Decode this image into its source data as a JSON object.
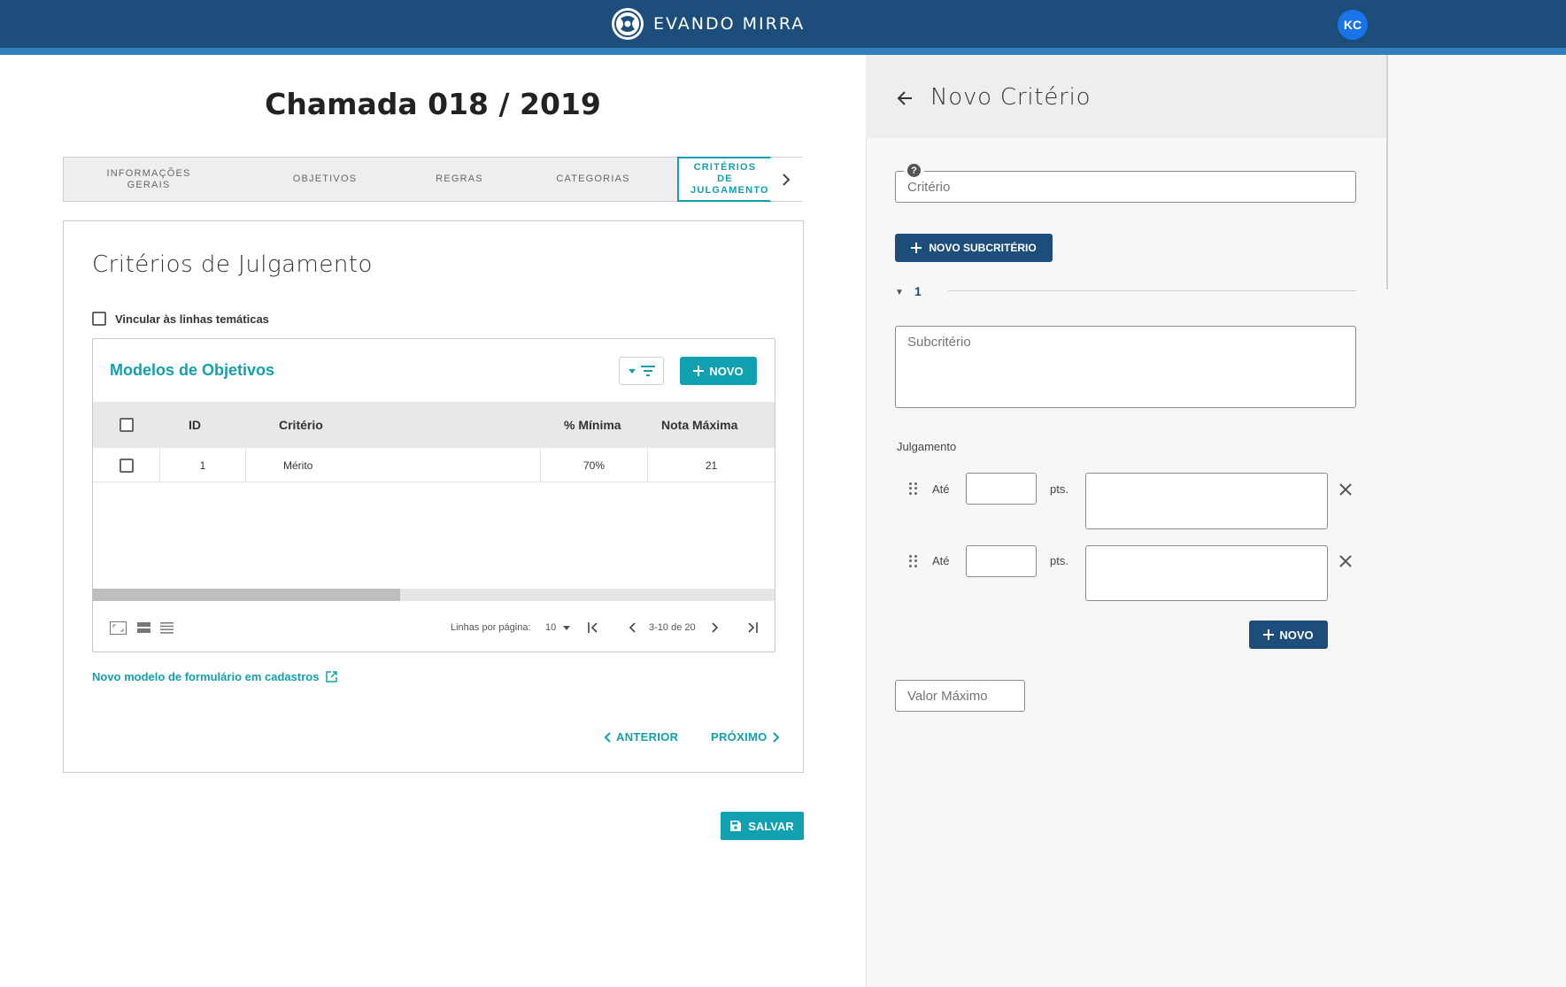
{
  "header": {
    "brand": "EVANDO MIRRA",
    "avatar_initials": "KC"
  },
  "page": {
    "title": "Chamada 018 / 2019"
  },
  "stepper": {
    "steps": [
      {
        "label": "INFORMAÇÕES GERAIS"
      },
      {
        "label": "OBJETIVOS"
      },
      {
        "label": "REGRAS"
      },
      {
        "label": "CATEGORIAS"
      },
      {
        "label": "CRITÉRIOS DE JULGAMENTO",
        "active": true
      }
    ]
  },
  "card": {
    "title": "Critérios de Julgamento",
    "vincular_label": "Vincular às linhas temáticas",
    "table": {
      "title": "Modelos de Objetivos",
      "new_label": "NOVO",
      "columns": [
        "ID",
        "Critério",
        "% Mínima",
        "Nota Máxima"
      ],
      "rows": [
        {
          "id": "1",
          "criterio": "Mérito",
          "minima": "70%",
          "nota_maxima": "21"
        }
      ],
      "pagination": {
        "rows_per_page_label": "Linhas por página:",
        "rows_per_page": "10",
        "range": "3-10 de 20"
      },
      "scroll_fraction": 0.45
    },
    "cadastro_link": "Novo modelo de formulário em cadastros",
    "prev_label": "ANTERIOR",
    "next_label": "PRÓXIMO"
  },
  "save_label": "SALVAR",
  "panel": {
    "title": "Novo Critério",
    "criterio_placeholder": "Critério",
    "new_sub_label": "NOVO SUBCRITÉRIO",
    "accordion_number": "1",
    "subcriterio_placeholder": "Subcritério",
    "julgamento_label": "Julgamento",
    "julgamento_rows": [
      {
        "ate": "Até",
        "pts": "pts."
      },
      {
        "ate": "Até",
        "pts": "pts."
      }
    ],
    "new_label": "NOVO",
    "valor_maximo_placeholder": "Valor Máximo"
  },
  "colors": {
    "primary": "#1d4d7a",
    "accent": "#11a0b0",
    "stripe": "#2f7fbd"
  }
}
